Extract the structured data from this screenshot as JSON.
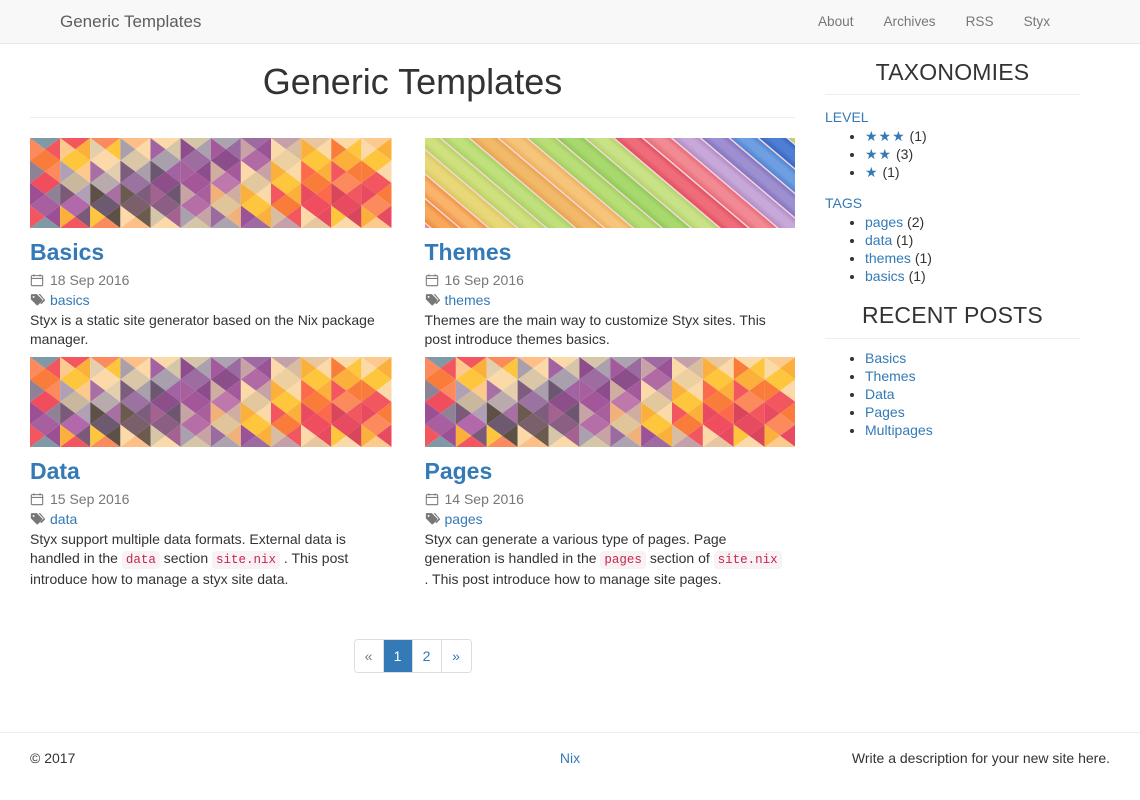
{
  "navbar": {
    "brand": "Generic Templates",
    "links": [
      {
        "label": "About"
      },
      {
        "label": "Archives"
      },
      {
        "label": "RSS"
      },
      {
        "label": "Styx"
      }
    ]
  },
  "page": {
    "title": "Generic Templates"
  },
  "posts": [
    {
      "title": "Basics",
      "date": "18 Sep 2016",
      "tag": "basics",
      "image": "geometric-diamonds",
      "excerpt_parts": [
        {
          "type": "text",
          "value": "Styx is a static site generator based on the Nix package manager."
        }
      ]
    },
    {
      "title": "Themes",
      "date": "16 Sep 2016",
      "tag": "themes",
      "image": "colored-chalk",
      "excerpt_parts": [
        {
          "type": "text",
          "value": "Themes are the main way to customize Styx sites. This post introduce themes basics."
        }
      ]
    },
    {
      "title": "Data",
      "date": "15 Sep 2016",
      "tag": "data",
      "image": "geometric-diamonds",
      "excerpt_parts": [
        {
          "type": "text",
          "value": "Styx support multiple data formats. External data is handled in the "
        },
        {
          "type": "code",
          "value": "data"
        },
        {
          "type": "text",
          "value": " section "
        },
        {
          "type": "code",
          "value": "site.nix"
        },
        {
          "type": "text",
          "value": " . This post introduce how to manage a styx site data."
        }
      ]
    },
    {
      "title": "Pages",
      "date": "14 Sep 2016",
      "tag": "pages",
      "image": "geometric-diamonds",
      "excerpt_parts": [
        {
          "type": "text",
          "value": "Styx can generate a various type of pages. Page generation is handled in the "
        },
        {
          "type": "code",
          "value": "pages"
        },
        {
          "type": "text",
          "value": " section of "
        },
        {
          "type": "code",
          "value": "site.nix"
        },
        {
          "type": "text",
          "value": " . This post introduce how to manage site pages."
        }
      ]
    }
  ],
  "pagination": {
    "prev_label": "«",
    "next_label": "»",
    "pages": [
      {
        "label": "1",
        "active": true
      },
      {
        "label": "2",
        "active": false
      }
    ],
    "prev_disabled": true,
    "next_disabled": false
  },
  "sidebar": {
    "taxonomies_title": "TAXONOMIES",
    "taxonomies": [
      {
        "name": "LEVEL",
        "items": [
          {
            "label": "★★★",
            "is_stars": true,
            "count": "(1)"
          },
          {
            "label": "★★",
            "is_stars": true,
            "count": "(3)"
          },
          {
            "label": "★",
            "is_stars": true,
            "count": "(1)"
          }
        ]
      },
      {
        "name": "TAGS",
        "items": [
          {
            "label": "pages",
            "is_stars": false,
            "count": "(2)"
          },
          {
            "label": "data",
            "is_stars": false,
            "count": "(1)"
          },
          {
            "label": "themes",
            "is_stars": false,
            "count": "(1)"
          },
          {
            "label": "basics",
            "is_stars": false,
            "count": "(1)"
          }
        ]
      }
    ],
    "recent_title": "RECENT POSTS",
    "recent_posts": [
      {
        "label": "Basics"
      },
      {
        "label": "Themes"
      },
      {
        "label": "Data"
      },
      {
        "label": "Pages"
      },
      {
        "label": "Multipages"
      }
    ]
  },
  "footer": {
    "copyright": "© 2017",
    "center_link": "Nix",
    "description": "Write a description for your new site here."
  },
  "colors": {
    "link": "#337ab7",
    "active_page": "#337ab7",
    "muted": "#777777",
    "code_text": "#c7254e",
    "code_bg": "#f9f2f4"
  }
}
